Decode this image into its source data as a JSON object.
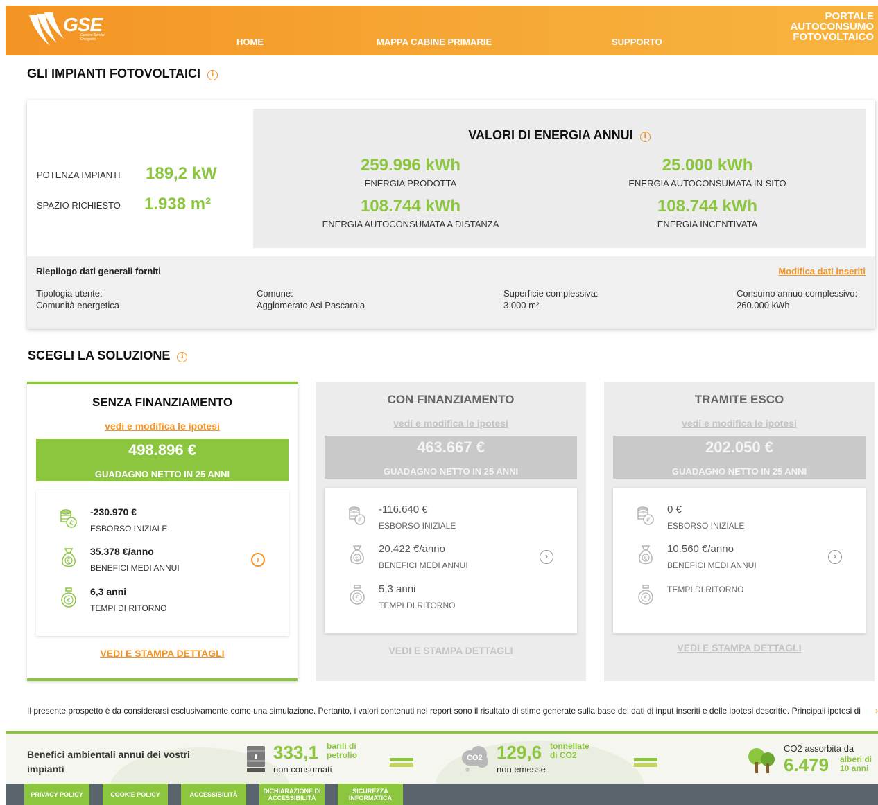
{
  "header": {
    "logo_text": "GSE",
    "logo_sub": "Gestore Servizi Energetici",
    "nav": [
      "HOME",
      "MAPPA CABINE PRIMARIE",
      "SUPPORTO"
    ],
    "portal_title": [
      "PORTALE",
      "AUTOCONSUMO",
      "FOTOVOLTAICO"
    ]
  },
  "impianti": {
    "title": "GLI IMPIANTI FOTOVOLTAICI",
    "potenza_label": "POTENZA IMPIANTI",
    "potenza_value": "189,2 kW",
    "spazio_label": "SPAZIO RICHIESTO",
    "spazio_value": "1.938 m²"
  },
  "energia": {
    "title": "VALORI DI ENERGIA ANNUI",
    "items": [
      {
        "value": "259.996 kWh",
        "label": "ENERGIA PRODOTTA"
      },
      {
        "value": "25.000 kWh",
        "label": "ENERGIA AUTOCONSUMATA IN SITO"
      },
      {
        "value": "108.744 kWh",
        "label": "ENERGIA AUTOCONSUMATA A DISTANZA"
      },
      {
        "value": "108.744 kWh",
        "label": "ENERGIA INCENTIVATA"
      }
    ]
  },
  "riepilogo": {
    "title": "Riepilogo dati generali forniti",
    "edit_link": "Modifica dati inseriti",
    "fields": [
      {
        "label": "Tipologia utente:",
        "value": "Comunità energetica"
      },
      {
        "label": "Comune:",
        "value": "Agglomerato Asi Pascarola"
      },
      {
        "label": "Superficie complessiva:",
        "value": "3.000 m²"
      },
      {
        "label": "Consumo annuo complessivo:",
        "value": "260.000 kWh"
      }
    ]
  },
  "soluzione": {
    "title": "SCEGLI LA SOLUZIONE",
    "cards": [
      {
        "title": "SENZA FINANZIAMENTO",
        "link": "vedi e modifica le ipotesi",
        "gain": "498.896 €",
        "gain_label": "GUADAGNO NETTO IN 25 ANNI",
        "metrics": [
          {
            "value": "-230.970 €",
            "label": "ESBORSO INIZIALE"
          },
          {
            "value": "35.378 €/anno",
            "label": "BENEFICI MEDI ANNUI"
          },
          {
            "value": "6,3 anni",
            "label": "TEMPI DI RITORNO"
          }
        ],
        "print": "VEDI E STAMPA DETTAGLI"
      },
      {
        "title": "CON FINANZIAMENTO",
        "link": "vedi e modifica le ipotesi",
        "gain": "463.667 €",
        "gain_label": "GUADAGNO NETTO IN 25 ANNI",
        "metrics": [
          {
            "value": "-116.640 €",
            "label": "ESBORSO INIZIALE"
          },
          {
            "value": "20.422 €/anno",
            "label": "BENEFICI MEDI ANNUI"
          },
          {
            "value": "5,3 anni",
            "label": "TEMPI DI RITORNO"
          }
        ],
        "print": "VEDI E STAMPA DETTAGLI"
      },
      {
        "title": "TRAMITE ESCO",
        "link": "vedi e modifica le ipotesi",
        "gain": "202.050 €",
        "gain_label": "GUADAGNO NETTO IN 25 ANNI",
        "metrics": [
          {
            "value": "0 €",
            "label": "ESBORSO INIZIALE"
          },
          {
            "value": "10.560 €/anno",
            "label": "BENEFICI MEDI ANNUI"
          },
          {
            "value": "",
            "label": "TEMPI DI RITORNO"
          }
        ],
        "print": "VEDI E STAMPA DETTAGLI"
      }
    ]
  },
  "disclaimer": "Il presente prospetto è da considerarsi esclusivamente come una simulazione. Pertanto, i valori contenuti nel report sono il risultato di stime generate sulla base dei dati di input inseriti e delle ipotesi descritte. Principali ipotesi di",
  "ambiente": {
    "title": "Benefici ambientali annui dei vostri impianti",
    "petrolio_value": "333,1",
    "petrolio_unit": "barili di petrolio",
    "petrolio_sub": "non consumati",
    "co2_icon": "CO2",
    "co2_value": "129,6",
    "co2_unit": "tonnellate di CO2",
    "co2_sub": "non emesse",
    "alberi_head": "CO2 assorbita da",
    "alberi_value": "6.479",
    "alberi_unit": "alberi di 10 anni"
  },
  "footer": {
    "links": [
      "PRIVACY POLICY",
      "COOKIE POLICY",
      "ACCESSIBILITÀ",
      "DICHIARAZIONE DI ACCESSIBILITÀ",
      "SICUREZZA INFORMATICA"
    ]
  },
  "colors": {
    "accent_orange": "#f39424",
    "accent_green": "#8cc63f",
    "footer_gray": "#5a646d"
  }
}
